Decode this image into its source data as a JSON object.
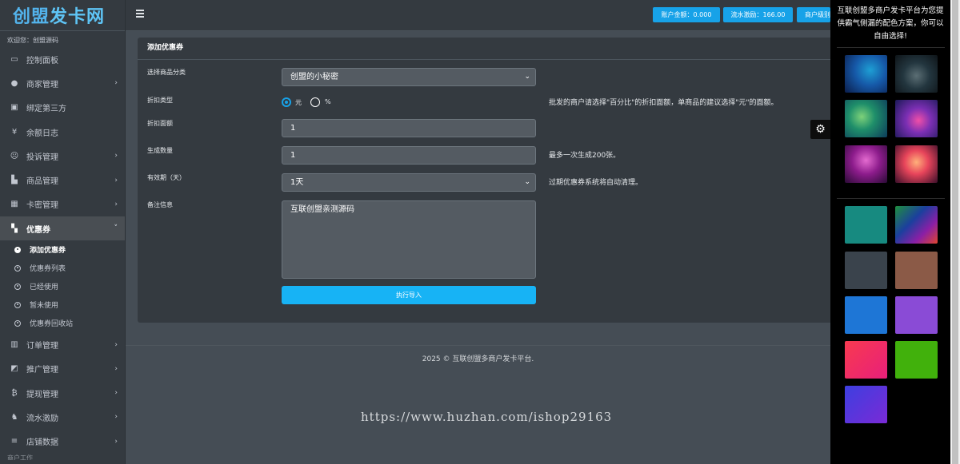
{
  "brand": {
    "part1": "创盟",
    "part2": "发卡网"
  },
  "sidebar": {
    "welcome": "欢迎您：创盟源码",
    "items": [
      {
        "label": "控制面板",
        "icon": "monitor-icon",
        "glyph": "▭",
        "chev": ""
      },
      {
        "label": "商家管理",
        "icon": "user-circle-icon",
        "glyph": "●",
        "chev": "›"
      },
      {
        "label": "绑定第三方",
        "icon": "id-card-icon",
        "glyph": "▣",
        "chev": ""
      },
      {
        "label": "余额日志",
        "icon": "yen-icon",
        "glyph": "¥",
        "chev": ""
      },
      {
        "label": "投诉管理",
        "icon": "frown-icon",
        "glyph": "☹",
        "chev": "›"
      },
      {
        "label": "商品管理",
        "icon": "shopping-bag-icon",
        "glyph": "▙",
        "chev": "›"
      },
      {
        "label": "卡密管理",
        "icon": "grid-icon",
        "glyph": "▦",
        "chev": "›"
      },
      {
        "label": "优惠券",
        "icon": "chess-board-icon",
        "glyph": "▚",
        "chev": "˅"
      }
    ],
    "sub_items": [
      {
        "label": "添加优惠券"
      },
      {
        "label": "优惠券列表"
      },
      {
        "label": "已经使用"
      },
      {
        "label": "暂未使用"
      },
      {
        "label": "优惠券回收站"
      }
    ],
    "items_after": [
      {
        "label": "订单管理",
        "icon": "bar-chart-icon",
        "glyph": "▥",
        "chev": "›"
      },
      {
        "label": "推广管理",
        "icon": "share-square-icon",
        "glyph": "◩",
        "chev": "›"
      },
      {
        "label": "提现管理",
        "icon": "bitcoin-icon",
        "glyph": "₿",
        "chev": "›"
      },
      {
        "label": "流水激励",
        "icon": "gitlab-icon",
        "glyph": "♞",
        "chev": "›"
      },
      {
        "label": "店铺数据",
        "icon": "database-icon",
        "glyph": "≡",
        "chev": "›"
      }
    ],
    "cut_label": "商户工作"
  },
  "topbar": {
    "balance": "账户金额：0.000",
    "flow": "流水激励：166.00",
    "level": "商户级别"
  },
  "form": {
    "title": "添加优惠券",
    "category_label": "选择商品分类",
    "category_value": "创盟的小秘密",
    "discount_type_label": "折扣类型",
    "type_option_yuan": "元",
    "type_option_percent": "%",
    "discount_help": "批发的商户请选择\"百分比\"的折扣面额，单商品的建议选择\"元\"的面额。",
    "amount_label": "折扣面额",
    "amount_value": "1",
    "count_label": "生成数量",
    "count_value": "1",
    "count_help": "最多一次生成200张。",
    "validity_label": "有效期（天）",
    "validity_value": "1天",
    "validity_help": "过期优惠券系统将自动清理。",
    "remark_label": "备注信息",
    "remark_value": "互联创盟亲测源码",
    "submit_label": "执行导入"
  },
  "footer": {
    "text": "2025 © 互联创盟多商户发卡平台."
  },
  "watermark": "https://www.huzhan.com/ishop29163",
  "panel": {
    "title": "互联创盟多商户发卡平台为您提供霸气侧漏的配色方案，你可以自由选择!",
    "image_swatches": 6,
    "color_swatches": [
      "#178a80",
      "gradient-multi",
      "#3a434c",
      "#8b5a47",
      "#1e76d6",
      "#8a4bd6",
      "#f0285f",
      "#41b10c",
      "#5a2ede"
    ]
  },
  "colors": {
    "accent": "#17a2e8",
    "sidebar_bg": "#343a40",
    "content_bg": "#454d55"
  }
}
